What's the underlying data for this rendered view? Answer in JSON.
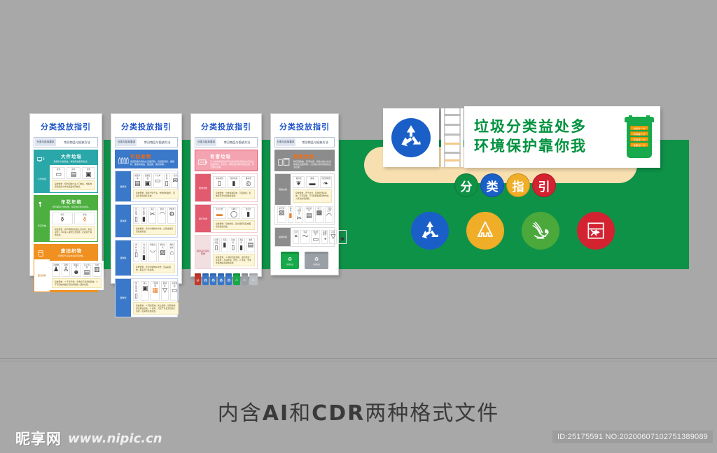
{
  "meta": {
    "caption": "内含AI和CDR两种格式文件",
    "caption_plain_1": "内含",
    "caption_bold_1": "AI",
    "caption_plain_2": "和",
    "caption_bold_2": "CDR",
    "caption_plain_3": "两种格式文件"
  },
  "watermark": {
    "logo": "昵享网",
    "url": "www.nipic.cn",
    "id_text": "ID:25175591 NO:20200607102751389089"
  },
  "colors": {
    "background": "#a8a8a8",
    "green_wall": "#0e9248",
    "tan": "#f8dfb0",
    "slogan_green": "#00923f",
    "blue": "#1a5fc8",
    "yellow": "#f0ad28",
    "red": "#d32230",
    "panel_title_blue": "#1f54c8"
  },
  "header": {
    "recycle_icon": "recycle-icon",
    "slogan_line1": "垃圾分类益处多",
    "slogan_line2": "环境保护靠你我",
    "bin_tags": [
      "垃圾分一分",
      "环境美十分",
      "环境美一分",
      "健康加一分"
    ]
  },
  "word_circles": [
    {
      "char": "分",
      "color": "#0f9246"
    },
    {
      "char": "类",
      "color": "#1a5fc8"
    },
    {
      "char": "指",
      "color": "#f0ad28"
    },
    {
      "char": "引",
      "color": "#d32230"
    }
  ],
  "icon_circles": [
    {
      "name": "recyclable-icon",
      "color": "#1a5fc8",
      "label": "可回收物"
    },
    {
      "name": "other-waste-icon",
      "color": "#f0ad28",
      "label": "其他垃圾"
    },
    {
      "name": "food-waste-icon",
      "color": "#4aa93a",
      "label": "厨余垃圾"
    },
    {
      "name": "hazardous-waste-icon",
      "color": "#d32230",
      "label": "有害垃圾"
    }
  ],
  "panels": [
    {
      "title": "分类投放指引",
      "tab1": "分类与投放要求",
      "tab2": "常见物品与投放方法",
      "sections": [
        {
          "color": "#2aa7a8",
          "icon": "sofa-icon",
          "title": "大件垃圾",
          "subtitle": "按指引分类投放，单独存放指定地点。",
          "side": "大件垃圾",
          "chips": [
            {
              "label": "家具",
              "gly": "🛋"
            },
            {
              "label": "床垫",
              "gly": "🛏"
            },
            {
              "label": "家电",
              "gly": "📺"
            }
          ],
          "note": "投放要求：预约回收企业上门收运，或投放至指定的大件垃圾临时存放点。"
        },
        {
          "color": "#4caf3f",
          "icon": "flower-icon",
          "title": "年花年桔",
          "subtitle": "春节期间分类投放，指定地点集中收运。",
          "side": "年花年桔",
          "chips": [
            {
              "label": "年花",
              "gly": "🌷"
            },
            {
              "label": "年桔",
              "gly": "🍊"
            }
          ],
          "note": "投放要求：春节期间按社区公告时间、地点投放；不得混入其他生活垃圾；花盆属于其他垃圾。"
        },
        {
          "color": "#f09020",
          "icon": "clothes-icon",
          "title": "废旧织物",
          "subtitle": "清洗晾干后投放指定回收箱。",
          "side": "废旧织物",
          "chips": [
            {
              "label": "旧衣物",
              "gly": "👕"
            },
            {
              "label": "鞋帽",
              "gly": "👞"
            },
            {
              "label": "毛绒玩具",
              "gly": "🧸"
            },
            {
              "label": "床上用品",
              "gly": "🛌"
            },
            {
              "label": "包袋",
              "gly": "👜"
            }
          ],
          "note": "投放要求：① 干净干燥，清洗晾干后装袋投放；② 不可回收的破损污损织物投入其他垃圾。"
        }
      ]
    },
    {
      "title": "分类投放指引",
      "tab1": "分类与投放要求",
      "tab2": "常见物品与投放方法",
      "banner": {
        "color": "#3a78c9",
        "title": "可回收物",
        "subtitle": "适宜回收利用的生活废弃物，包括废纸张、废塑料、废玻璃制品、废金属、废织物等。"
      },
      "sections": [
        {
          "color": "#3a78c9",
          "side": "废纸张",
          "chips": [
            {
              "label": "报纸书本",
              "gly": "📰"
            },
            {
              "label": "纸箱纸板",
              "gly": "📦"
            },
            {
              "label": "广告单",
              "gly": "📄"
            },
            {
              "label": "纸袋",
              "gly": "🛍"
            },
            {
              "label": "信封",
              "gly": "✉"
            }
          ],
          "note": "投放要求：保持干燥干净，去除塑料胶带，压扁折叠后捆扎投放。"
        },
        {
          "color": "#3a78c9",
          "side": "废金属",
          "chips": [
            {
              "label": "易拉罐",
              "gly": "🥫"
            },
            {
              "label": "金属罐",
              "gly": "🔩"
            },
            {
              "label": "铁钉",
              "gly": "🔧"
            },
            {
              "label": "锅具",
              "gly": "🍳"
            },
            {
              "label": "金属件",
              "gly": "⚙"
            },
            {
              "label": "刀具",
              "gly": "🔪"
            },
            {
              "label": "勺子",
              "gly": "🥄"
            }
          ],
          "note": "投放要求：清空内容物并冲洗，尖锐金属需包裹后投放。"
        },
        {
          "color": "#3a78c9",
          "side": "废塑料",
          "chips": [
            {
              "label": "塑料瓶",
              "gly": "🧴"
            },
            {
              "label": "洗发水瓶",
              "gly": "🧴"
            },
            {
              "label": "塑料盆",
              "gly": "🪣"
            },
            {
              "label": "塑料玩具",
              "gly": "🧩"
            },
            {
              "label": "塑料衣架",
              "gly": "👔"
            },
            {
              "label": "泡沫箱",
              "gly": "📦"
            },
            {
              "label": "塑料桶",
              "gly": "🪣"
            }
          ],
          "note": "投放要求：清空内容物并冲洗，压扁后投放，瓶盖可一并投放。"
        },
        {
          "color": "#3a78c9",
          "side": "废玻璃",
          "chips": [
            {
              "label": "玻璃瓶罐",
              "gly": "🍾"
            },
            {
              "label": "镜子",
              "gly": "🪞"
            },
            {
              "label": "门窗玻璃",
              "gly": "🪟"
            },
            {
              "label": "玻璃杯",
              "gly": "🥛"
            },
            {
              "label": "平板玻璃",
              "gly": "🧊"
            }
          ],
          "note": "投放要求：① 轻投轻放，防止破碎；易碎玻璃需包裹后投放。② 成色、污损严重且无回收价值的，按其他垃圾投放。"
        }
      ]
    },
    {
      "title": "分类投放指引",
      "tab1": "分类与投放要求",
      "tab2": "常见物品与投放方法",
      "banner": {
        "color": "#e8566c",
        "title": "有害垃圾",
        "subtitle": "对人体健康或自然环境造成直接或潜在危害的生活废弃物。投放时，需轻放并保持包装完整，防止破损泄漏。"
      },
      "sections": [
        {
          "color": "#e15a6e",
          "side": "废电池类",
          "chips": [
            {
              "label": "充电电池",
              "gly": "🔋"
            },
            {
              "label": "纽扣电池",
              "gly": "⚪"
            },
            {
              "label": "蓄电池",
              "gly": "🔌"
            }
          ],
          "note": "投放要求：分类单独存放，不得破损；投放至有害垃圾收集容器。"
        },
        {
          "color": "#e15a6e",
          "side": "废灯管类",
          "chips": [
            {
              "label": "荧光灯管",
              "gly": "💡"
            },
            {
              "label": "节能灯",
              "gly": "💡"
            },
            {
              "label": "温度计",
              "gly": "🌡"
            }
          ],
          "note": "投放要求：轻放防碎，建议用原包装或报纸包裹后投放。"
        },
        {
          "color": "#e15a6e",
          "side": "废药品及其包装物",
          "chips": [
            {
              "label": "过期药品",
              "gly": "💊"
            },
            {
              "label": "药瓶",
              "gly": "🧪"
            },
            {
              "label": "杀虫剂",
              "gly": "🧴"
            },
            {
              "label": "消毒剂",
              "gly": "🧪"
            },
            {
              "label": "油漆",
              "gly": "🎨"
            }
          ],
          "note": "投放要求：① 保持包装完整，连同包装一并投放；不得倾倒、焚烧。② 含汞、含重金属物品需单独投放。"
        }
      ],
      "bins": [
        {
          "color": "#c0392b",
          "lid": "#a93226"
        },
        {
          "color": "#3a78c9",
          "lid": "#2f63ab"
        },
        {
          "color": "#3a78c9",
          "lid": "#2f63ab"
        },
        {
          "color": "#3a78c9",
          "lid": "#2f63ab"
        },
        {
          "color": "#3a78c9",
          "lid": "#2f63ab"
        },
        {
          "color": "#17a94b",
          "lid": "#138d3e"
        },
        {
          "color": "#9aa0a6",
          "lid": "#868b90"
        },
        {
          "color": "#b9bec3",
          "lid": "#a3a8ad"
        }
      ]
    },
    {
      "title": "分类投放指引",
      "tab1": "分类与投放要求",
      "tab2": "常见物品与投放方法",
      "banner": {
        "color": "#8c8c8c",
        "title": "其他垃圾",
        "subtitle": "除可回收物、有害垃圾、厨余垃圾以外的其他生活废弃物，以及难以辨识类别的生活垃圾。"
      },
      "sections": [
        {
          "color": "#8c8c8c",
          "side": "其他垃圾",
          "chips": [
            {
              "label": "餐巾纸",
              "gly": "🧻"
            },
            {
              "label": "烟蒂",
              "gly": "🚬"
            },
            {
              "label": "污损塑料袋",
              "gly": "🛍"
            }
          ],
          "note": "投放要求：沥干水分，装袋密闭后投放。不可回收、不可降解的废弃物均投入其他垃圾容器。",
          "chips2": [
            {
              "label": "尿不湿",
              "gly": "🩲"
            },
            {
              "label": "陶瓷",
              "gly": "🏺"
            },
            {
              "label": "一次性餐具",
              "gly": "🍴"
            },
            {
              "label": "破旧毛巾",
              "gly": "🧺"
            },
            {
              "label": "灰土",
              "gly": "🪨"
            },
            {
              "label": "一次性口罩",
              "gly": "😷"
            }
          ]
        },
        {
          "color": "#8c8c8c",
          "side": "其他垃圾",
          "chips": [
            {
              "label": "贝壳",
              "gly": "🐚"
            },
            {
              "label": "毛发",
              "gly": "🧶"
            },
            {
              "label": "污损纸张",
              "gly": "📄"
            },
            {
              "label": "动物粪便",
              "gly": "💩"
            },
            {
              "label": "花盆",
              "gly": "🪴"
            },
            {
              "label": "碎玻璃",
              "gly": "🧊"
            }
          ]
        }
      ],
      "bins_large": [
        {
          "color": "#17a94b",
          "label": "其他垃圾"
        },
        {
          "color": "#9aa0a6",
          "label": "其他垃圾"
        }
      ]
    }
  ]
}
